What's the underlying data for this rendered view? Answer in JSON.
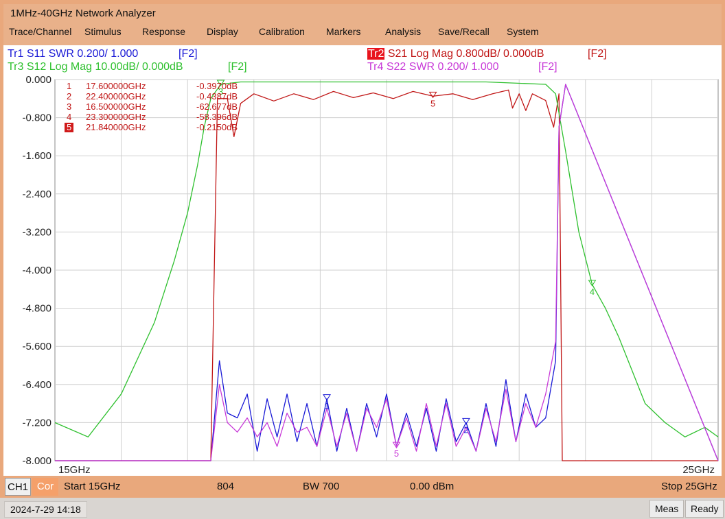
{
  "window": {
    "title": "1MHz-40GHz Network Analyzer"
  },
  "menu": [
    "Trace/Channel",
    "Stimulus",
    "Response",
    "Display",
    "Calibration",
    "Markers",
    "Analysis",
    "Save/Recall",
    "System"
  ],
  "traces": {
    "tr1": {
      "text": "Tr1 S11 SWR 0.200/ 1.000",
      "tag": "[F2]",
      "color": "#1a1ad6"
    },
    "tr2": {
      "badge": "Tr2",
      "text": "S21 Log Mag 0.800dB/ 0.000dB",
      "tag": "[F2]",
      "color": "#c01515"
    },
    "tr3": {
      "text": "Tr3 S12 Log Mag 10.00dB/ 0.000dB",
      "tag": "[F2]",
      "color": "#2ec02e"
    },
    "tr4": {
      "text": "Tr4 S22 SWR 0.200/ 1.000",
      "tag": "[F2]",
      "color": "#c83ad8"
    }
  },
  "markers": [
    {
      "num": "1",
      "freq": "17.600000GHz",
      "value": "-0.3970dB",
      "active": false
    },
    {
      "num": "2",
      "freq": "22.400000GHz",
      "value": "-0.4387dB",
      "active": false
    },
    {
      "num": "3",
      "freq": "16.500000GHz",
      "value": "-62.677dB",
      "active": false
    },
    {
      "num": "4",
      "freq": "23.300000GHz",
      "value": "-58.396dB",
      "active": false
    },
    {
      "num": "5",
      "freq": "21.840000GHz",
      "value": "-0.2150dB",
      "active": true
    }
  ],
  "status": {
    "channel": "CH1",
    "correction": "Cor",
    "start": "Start 15GHz",
    "points": "804",
    "bw": "BW 700",
    "power": "0.00 dBm",
    "stop": "Stop 25GHz"
  },
  "bottom": {
    "datetime": "2024-7-29 14:18",
    "meas": "Meas",
    "ready": "Ready"
  },
  "chart_data": {
    "type": "line",
    "x_unit": "GHz",
    "xlim": [
      15,
      25
    ],
    "x_tick_labels": [
      "15GHz",
      "25GHz"
    ],
    "ylim": [
      -8.0,
      0.0
    ],
    "y_ticks": [
      0.0,
      -0.8,
      -1.6,
      -2.4,
      -3.2,
      -4.0,
      -4.8,
      -5.6,
      -6.4,
      -7.2,
      -8.0
    ],
    "y_tick_labels": [
      "0.000",
      "-0.800",
      "-1.600",
      "-2.400",
      "-3.200",
      "-4.000",
      "-4.800",
      "-5.600",
      "-6.400",
      "-7.200",
      "-8.000"
    ],
    "grid": true,
    "series": [
      {
        "name": "Tr1 S11",
        "color": "#1a1ad6",
        "label_markers": [
          "1",
          "2"
        ],
        "x": [
          15,
          17.35,
          17.48,
          17.6,
          17.75,
          17.9,
          18.05,
          18.2,
          18.35,
          18.5,
          18.65,
          18.8,
          18.95,
          19.1,
          19.25,
          19.4,
          19.55,
          19.7,
          19.85,
          20.0,
          20.15,
          20.3,
          20.45,
          20.6,
          20.75,
          20.9,
          21.05,
          21.2,
          21.35,
          21.5,
          21.65,
          21.8,
          21.95,
          22.1,
          22.25,
          22.4,
          22.55,
          22.6,
          22.7,
          25
        ],
        "y": [
          -8.0,
          -8.0,
          -5.9,
          -7.0,
          -7.1,
          -6.6,
          -7.8,
          -6.7,
          -7.5,
          -6.6,
          -7.6,
          -6.8,
          -7.7,
          -6.7,
          -7.8,
          -6.9,
          -7.8,
          -6.8,
          -7.5,
          -6.6,
          -7.7,
          -7.0,
          -7.7,
          -6.9,
          -7.8,
          -6.7,
          -7.6,
          -7.2,
          -7.8,
          -6.8,
          -7.7,
          -6.3,
          -7.6,
          -6.6,
          -7.3,
          -7.1,
          -5.9,
          -1.0,
          -0.1,
          -8.0
        ]
      },
      {
        "name": "Tr2 S21",
        "color": "#c01515",
        "label_markers": [
          "5"
        ],
        "x": [
          15,
          17.35,
          17.45,
          17.6,
          17.7,
          17.8,
          18.0,
          18.3,
          18.6,
          18.9,
          19.2,
          19.5,
          19.8,
          20.1,
          20.4,
          20.7,
          21.0,
          21.3,
          21.6,
          21.84,
          21.9,
          22.0,
          22.1,
          22.2,
          22.4,
          22.52,
          22.6,
          22.65,
          25
        ],
        "y": [
          -8.0,
          -8.0,
          -0.4,
          -0.4,
          -1.2,
          -0.5,
          -0.3,
          -0.45,
          -0.3,
          -0.42,
          -0.25,
          -0.38,
          -0.28,
          -0.4,
          -0.25,
          -0.35,
          -0.3,
          -0.42,
          -0.3,
          -0.22,
          -0.6,
          -0.3,
          -0.65,
          -0.3,
          -0.44,
          -1.0,
          -0.3,
          -8.0,
          -8.0
        ]
      },
      {
        "name": "Tr3 S12",
        "color": "#2ec02e",
        "label_markers": [
          "3",
          "4"
        ],
        "x": [
          15,
          15.5,
          16.0,
          16.5,
          16.8,
          17.0,
          17.15,
          17.25,
          17.35,
          17.5,
          17.8,
          18.5,
          19.5,
          20.5,
          21.5,
          22.4,
          22.55,
          22.7,
          22.9,
          23.1,
          23.3,
          23.5,
          23.7,
          23.9,
          24.2,
          24.5,
          24.8,
          25
        ],
        "y": [
          -7.2,
          -7.5,
          -6.6,
          -5.1,
          -3.8,
          -2.8,
          -1.8,
          -1.0,
          -0.4,
          -0.1,
          -0.05,
          -0.05,
          -0.05,
          -0.05,
          -0.05,
          -0.1,
          -0.3,
          -1.5,
          -3.2,
          -4.3,
          -4.8,
          -5.4,
          -6.1,
          -6.8,
          -7.2,
          -7.5,
          -7.3,
          -7.5
        ]
      },
      {
        "name": "Tr4 S22",
        "color": "#c83ad8",
        "label_markers": [
          "5"
        ],
        "x": [
          15,
          17.35,
          17.48,
          17.6,
          17.75,
          17.9,
          18.05,
          18.2,
          18.35,
          18.5,
          18.65,
          18.8,
          18.95,
          19.1,
          19.25,
          19.4,
          19.55,
          19.7,
          19.85,
          20.0,
          20.15,
          20.3,
          20.45,
          20.6,
          20.75,
          20.9,
          21.05,
          21.2,
          21.35,
          21.5,
          21.65,
          21.8,
          21.95,
          22.1,
          22.25,
          22.4,
          22.55,
          22.6,
          22.7,
          25
        ],
        "y": [
          -8.0,
          -8.0,
          -6.4,
          -7.2,
          -7.4,
          -7.1,
          -7.5,
          -7.2,
          -7.7,
          -7.0,
          -7.4,
          -7.3,
          -7.7,
          -6.9,
          -7.7,
          -7.0,
          -7.8,
          -6.9,
          -7.3,
          -6.7,
          -7.7,
          -7.1,
          -7.8,
          -6.8,
          -7.7,
          -6.8,
          -7.7,
          -7.3,
          -7.8,
          -6.9,
          -7.6,
          -6.5,
          -7.6,
          -6.8,
          -7.3,
          -6.6,
          -5.5,
          -1.0,
          -0.1,
          -8.0
        ]
      }
    ]
  }
}
